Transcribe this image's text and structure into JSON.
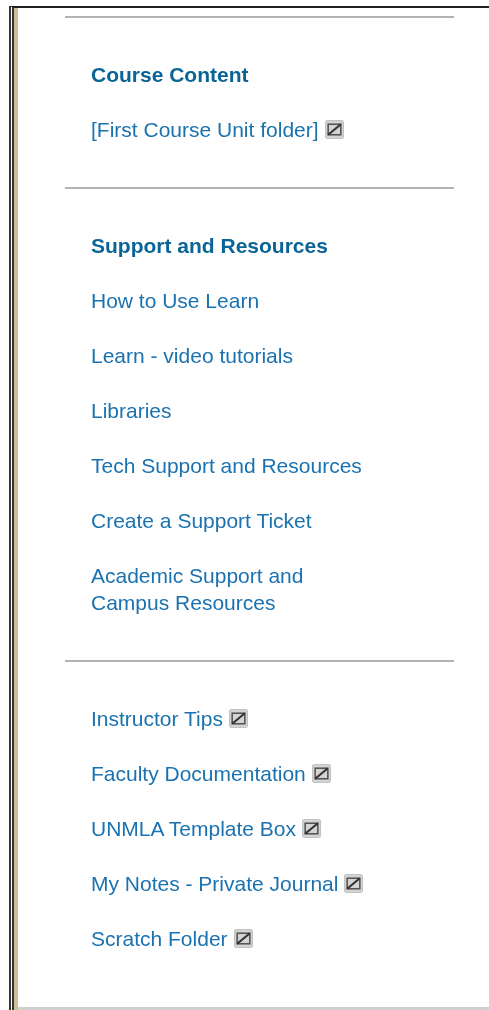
{
  "sections": [
    {
      "heading": "Course Content",
      "items": [
        {
          "label": "[First Course Unit folder]",
          "hidden": true
        }
      ]
    },
    {
      "heading": "Support and Resources",
      "items": [
        {
          "label": "How to Use Learn",
          "hidden": false
        },
        {
          "label": "Learn - video tutorials",
          "hidden": false
        },
        {
          "label": "Libraries",
          "hidden": false
        },
        {
          "label": "Tech Support and Resources",
          "hidden": false
        },
        {
          "label": "Create a Support Ticket",
          "hidden": false
        },
        {
          "label": "Academic Support and\nCampus Resources",
          "hidden": false
        }
      ]
    },
    {
      "items": [
        {
          "label": "Instructor Tips",
          "hidden": true
        },
        {
          "label": "Faculty Documentation",
          "hidden": true
        },
        {
          "label": "UNMLA Template Box",
          "hidden": true
        },
        {
          "label": "My Notes - Private Journal",
          "hidden": true
        },
        {
          "label": "Scratch Folder",
          "hidden": true
        }
      ]
    }
  ]
}
